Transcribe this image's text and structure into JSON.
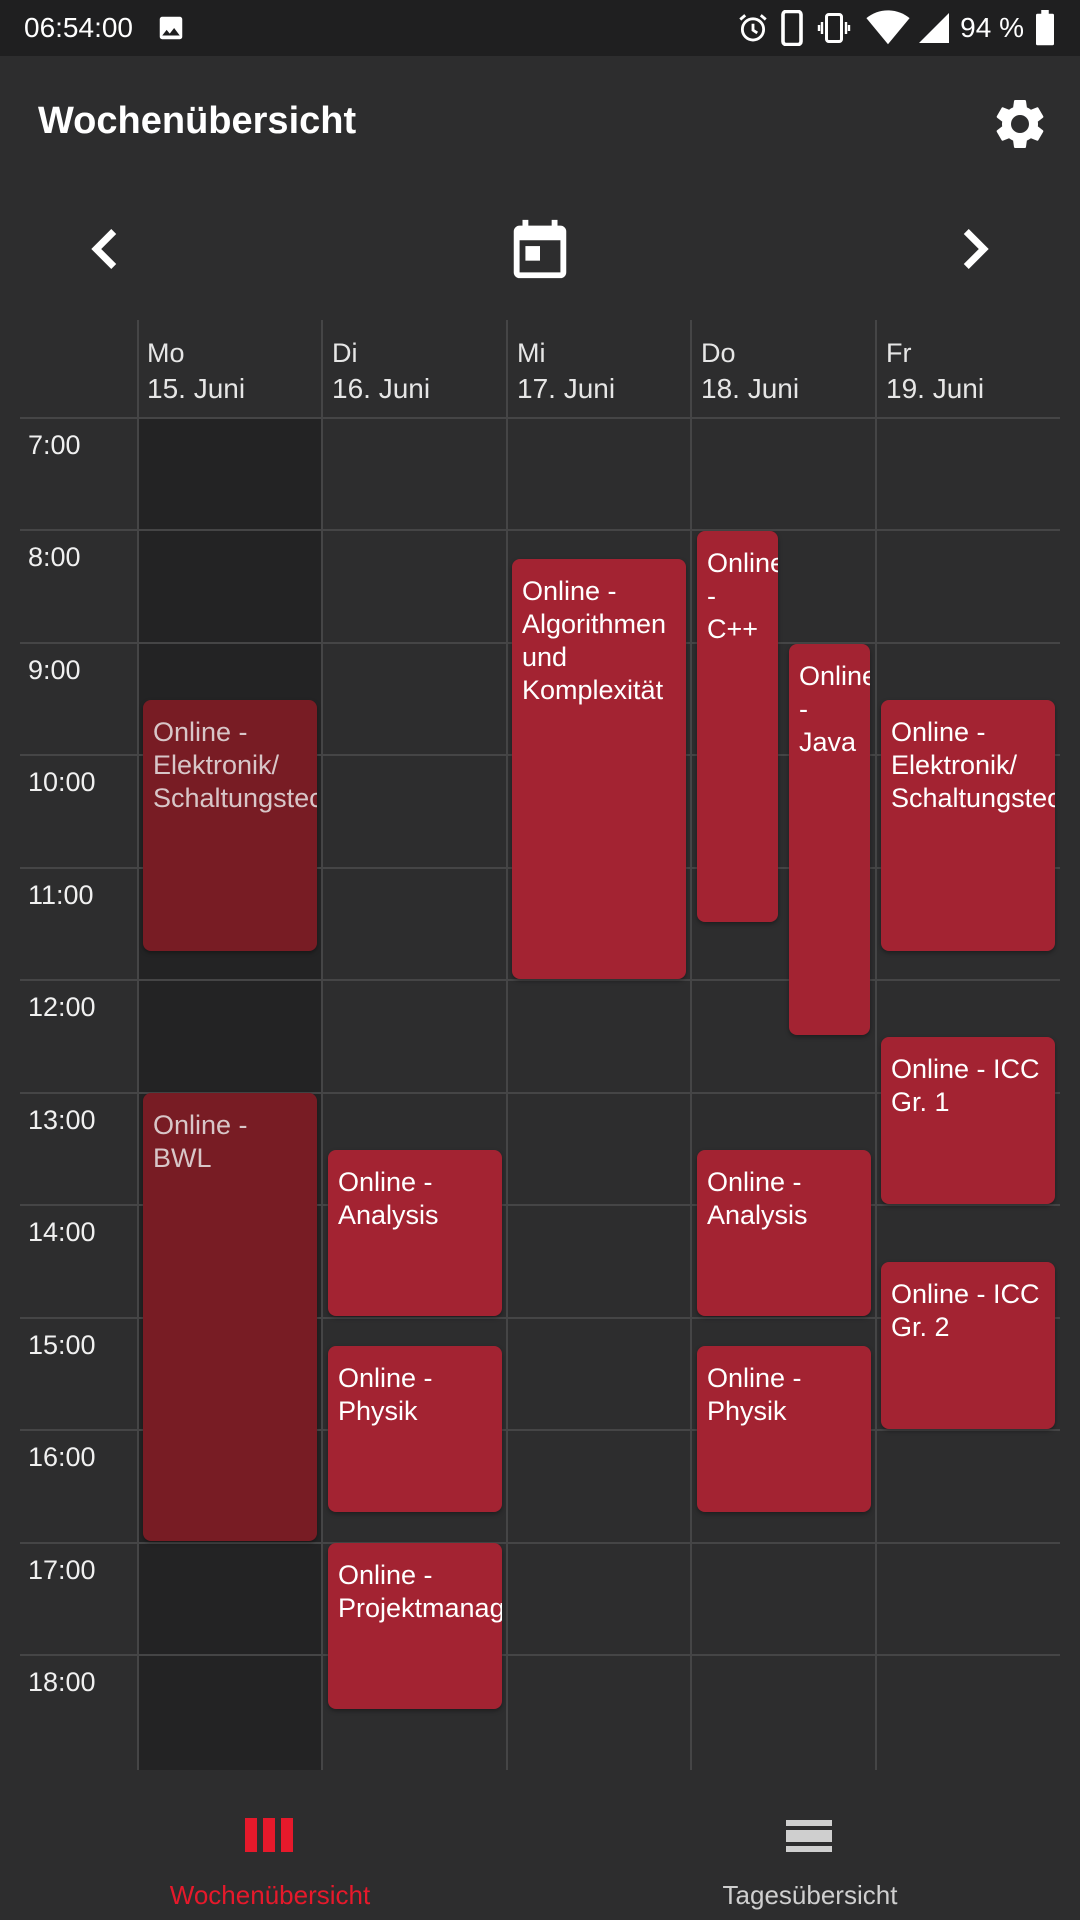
{
  "status_bar": {
    "time": "06:54:00",
    "battery": "94 %",
    "icons": [
      "image-icon",
      "alarm-icon",
      "phone-icon",
      "vibrate-icon",
      "wifi-icon",
      "signal-icon",
      "battery-icon"
    ]
  },
  "app_bar": {
    "title": "Wochenübersicht",
    "settings_icon": "gear-icon"
  },
  "week_nav": {
    "prev_icon": "chevron-left-icon",
    "calendar_icon": "calendar-today-icon",
    "next_icon": "chevron-right-icon"
  },
  "days": [
    {
      "dow": "Mo",
      "date": "15. Juni"
    },
    {
      "dow": "Di",
      "date": "16. Juni"
    },
    {
      "dow": "Mi",
      "date": "17. Juni"
    },
    {
      "dow": "Do",
      "date": "18. Juni"
    },
    {
      "dow": "Fr",
      "date": "19. Juni"
    }
  ],
  "hours": [
    "7:00",
    "8:00",
    "9:00",
    "10:00",
    "11:00",
    "12:00",
    "13:00",
    "14:00",
    "15:00",
    "16:00",
    "17:00",
    "18:00"
  ],
  "events": [
    {
      "title": "Online - Elektronik/ Schaltungstechnik",
      "day": "Mo"
    },
    {
      "title": "Online - BWL",
      "day": "Mo"
    },
    {
      "title": "Online - Analysis",
      "day": "Di"
    },
    {
      "title": "Online - Physik",
      "day": "Di"
    },
    {
      "title": "Online - Projektmanagement",
      "day": "Di"
    },
    {
      "title": "Online - Algorithmen und Komplexität",
      "day": "Mi"
    },
    {
      "title": "Online - C++",
      "day": "Do"
    },
    {
      "title": "Online - Java",
      "day": "Do"
    },
    {
      "title": "Online - Analysis",
      "day": "Do"
    },
    {
      "title": "Online - Physik",
      "day": "Do"
    },
    {
      "title": "Online - Elektronik/ Schaltungstechnik",
      "day": "Fr"
    },
    {
      "title": "Online - ICC Gr. 1",
      "day": "Fr"
    },
    {
      "title": "Online - ICC Gr. 2",
      "day": "Fr"
    }
  ],
  "colors": {
    "accent": "#e6192b",
    "event": "#a32332",
    "event_past": "#781c24",
    "background": "#2d2d2e"
  },
  "bottom_nav": {
    "week_label": "Wochenübersicht",
    "week_icon": "view-week-icon",
    "day_label": "Tagesübersicht",
    "day_icon": "view-day-icon"
  }
}
